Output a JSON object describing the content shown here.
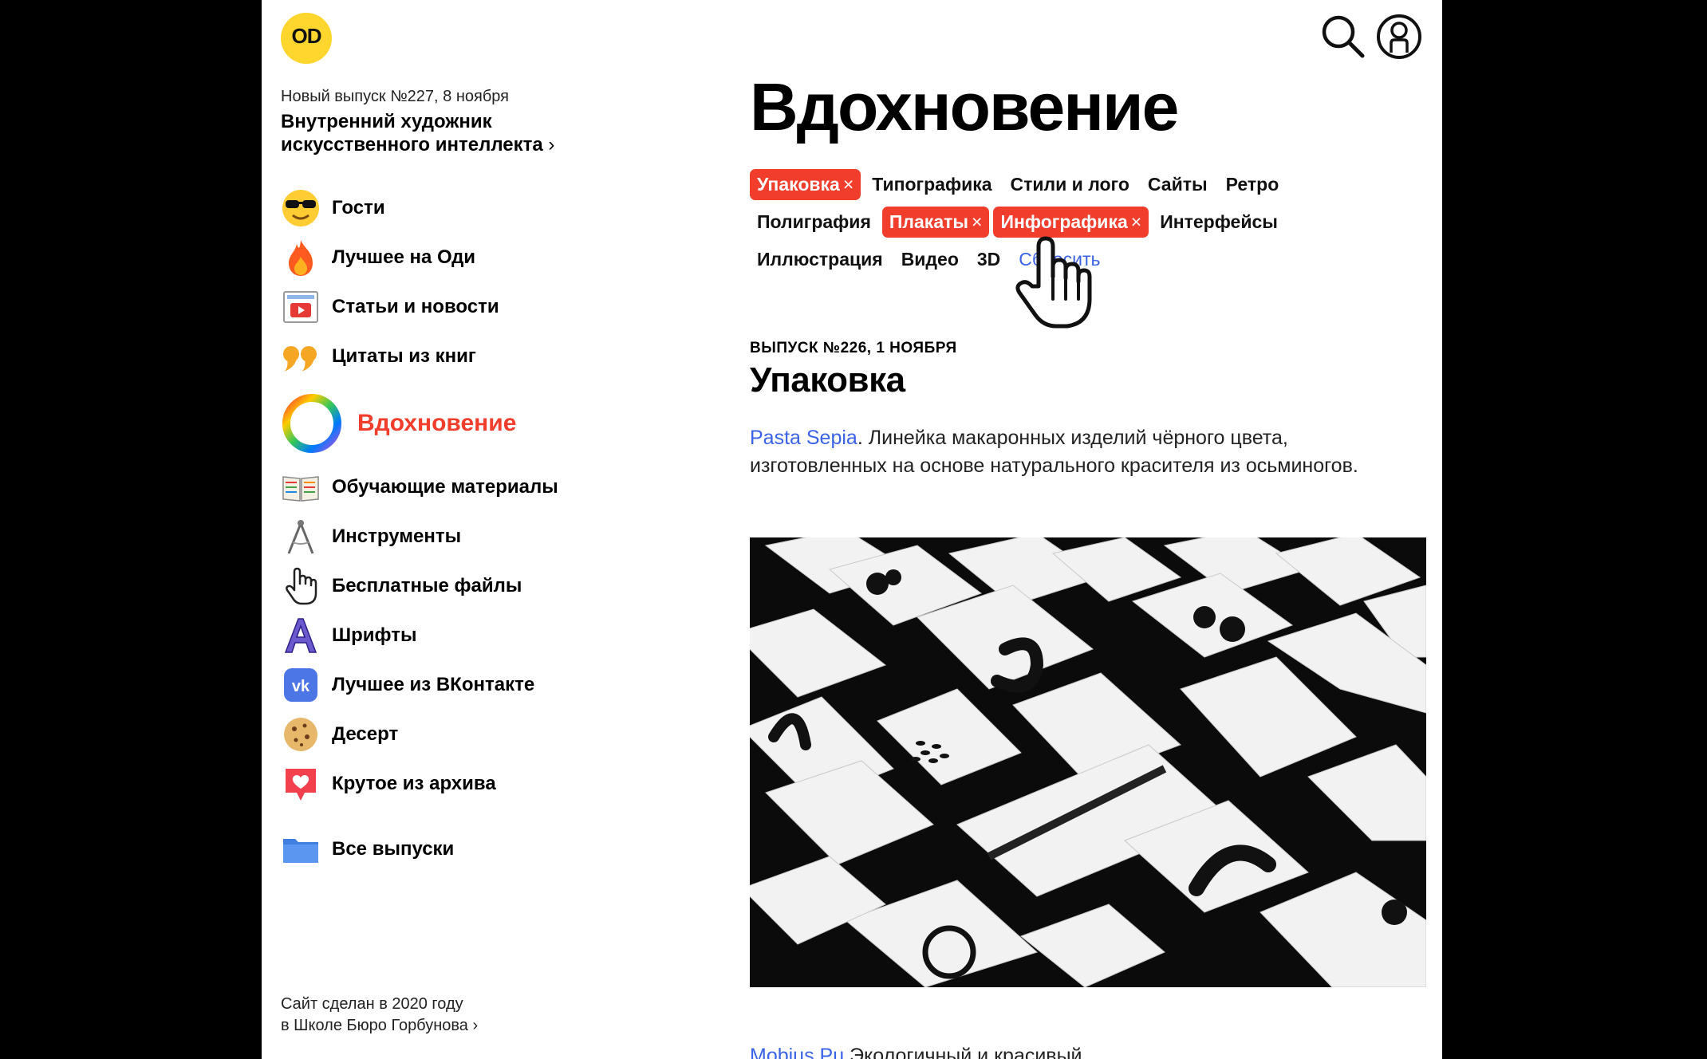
{
  "logo": {
    "text": "OD"
  },
  "issue": {
    "date": "Новый выпуск №227, 8 ноября",
    "title": "Внутренний художник искусственного интеллекта",
    "chevron": "›"
  },
  "nav": [
    {
      "label": "Гости",
      "icon": "sunglasses-emoji-icon"
    },
    {
      "label": "Лучшее на Оди",
      "icon": "fire-icon"
    },
    {
      "label": "Статьи и новости",
      "icon": "newspaper-icon"
    },
    {
      "label": "Цитаты из книг",
      "icon": "quote-icon"
    },
    {
      "label": "Вдохновение",
      "icon": "color-wheel-icon",
      "active": true
    },
    {
      "label": "Обучающие материалы",
      "icon": "textbook-icon"
    },
    {
      "label": "Инструменты",
      "icon": "compass-icon"
    },
    {
      "label": "Бесплатные файлы",
      "icon": "hand-icon"
    },
    {
      "label": "Шрифты",
      "icon": "letter-a-icon"
    },
    {
      "label": "Лучшее из ВКонтакте",
      "icon": "vk-icon"
    },
    {
      "label": "Десерт",
      "icon": "cookie-icon"
    },
    {
      "label": "Крутое из архива",
      "icon": "heart-icon"
    },
    {
      "label": "Все выпуски",
      "icon": "folder-icon"
    }
  ],
  "footer": {
    "line1": "Сайт сделан в 2020 году",
    "line2": "в Школе Бюро Горбунова",
    "chevron": "›"
  },
  "header": {
    "search_icon": "search-icon",
    "profile_icon": "user-icon"
  },
  "page_title": "Вдохновение",
  "tags": {
    "row1": [
      {
        "label": "Упаковка",
        "selected": true
      },
      {
        "label": "Типографика",
        "selected": false
      },
      {
        "label": "Стили и лого",
        "selected": false
      },
      {
        "label": "Сайты",
        "selected": false
      },
      {
        "label": "Ретро",
        "selected": false
      }
    ],
    "row2": [
      {
        "label": "Полиграфия",
        "selected": false
      },
      {
        "label": "Плакаты",
        "selected": true
      },
      {
        "label": "Инфографика",
        "selected": true
      },
      {
        "label": "Интерфейсы",
        "selected": false
      }
    ],
    "row3": [
      {
        "label": "Иллюстрация",
        "selected": false
      },
      {
        "label": "Видео",
        "selected": false
      },
      {
        "label": "3D",
        "selected": false
      },
      {
        "label": "Сбросить",
        "selected": false,
        "link": true
      }
    ],
    "remove_symbol": "×"
  },
  "publication": {
    "meta": "ВЫПУСК №226, 1 НОЯБРЯ",
    "title": "Упаковка",
    "link_text": "Pasta Sepia",
    "text": ". Линейка макаронных изделий чёрного цвета, изготовленных на основе натурального красителя из осьминогов.",
    "next_link": "Mobius Pu",
    "next_text": "Экологичный и красивый"
  },
  "colors": {
    "accent": "#f03d2c",
    "link": "#3b63e6",
    "logo": "#ffd62e"
  }
}
